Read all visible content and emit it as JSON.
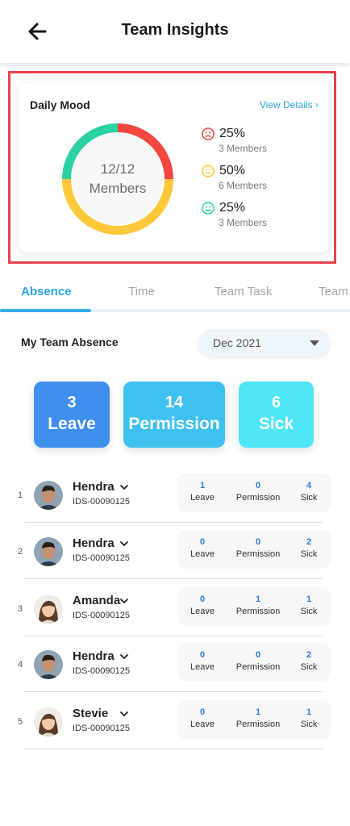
{
  "header": {
    "title": "Team Insights"
  },
  "mood": {
    "title": "Daily Mood",
    "view_details": "View Details ›",
    "center_count": "12/12",
    "center_label": "Members",
    "segments": [
      {
        "name": "sad",
        "percent": 25,
        "color": "#f2473f"
      },
      {
        "name": "neutral",
        "percent": 50,
        "color": "#fdc83a"
      },
      {
        "name": "happy",
        "percent": 25,
        "color": "#2bd1a0"
      }
    ],
    "legend": [
      {
        "face": "sad-face-icon",
        "color": "#f2473f",
        "pct": "25%",
        "members": "3 Members"
      },
      {
        "face": "neutral-face-icon",
        "color": "#fdc83a",
        "pct": "50%",
        "members": "6 Members"
      },
      {
        "face": "happy-face-icon",
        "color": "#2bd1a0",
        "pct": "25%",
        "members": "3 Members"
      }
    ]
  },
  "tabs": [
    "Absence",
    "Time",
    "Team Task",
    "Team"
  ],
  "absence": {
    "title": "My Team Absence",
    "month": "Dec 2021",
    "tiles": [
      {
        "num": "3",
        "label": "Leave",
        "color": "#3e8ff0"
      },
      {
        "num": "14",
        "label": "Permission",
        "color": "#3fc1ef"
      },
      {
        "num": "6",
        "label": "Sick",
        "color": "#4fe6f8"
      }
    ],
    "stat_labels": {
      "leave": "Leave",
      "permission": "Permission",
      "sick": "Sick"
    },
    "members": [
      {
        "idx": "1",
        "name": "Hendra",
        "id": "IDS-00090125",
        "leave": "1",
        "permission": "0",
        "sick": "4",
        "avatar": "male"
      },
      {
        "idx": "2",
        "name": "Hendra",
        "id": "IDS-00090125",
        "leave": "0",
        "permission": "0",
        "sick": "2",
        "avatar": "male"
      },
      {
        "idx": "3",
        "name": "Amanda",
        "id": "IDS-00090125",
        "leave": "0",
        "permission": "1",
        "sick": "1",
        "avatar": "female"
      },
      {
        "idx": "4",
        "name": "Hendra",
        "id": "IDS-00090125",
        "leave": "0",
        "permission": "0",
        "sick": "2",
        "avatar": "male"
      },
      {
        "idx": "5",
        "name": "Stevie",
        "id": "IDS-00090125",
        "leave": "0",
        "permission": "1",
        "sick": "1",
        "avatar": "female"
      }
    ]
  }
}
